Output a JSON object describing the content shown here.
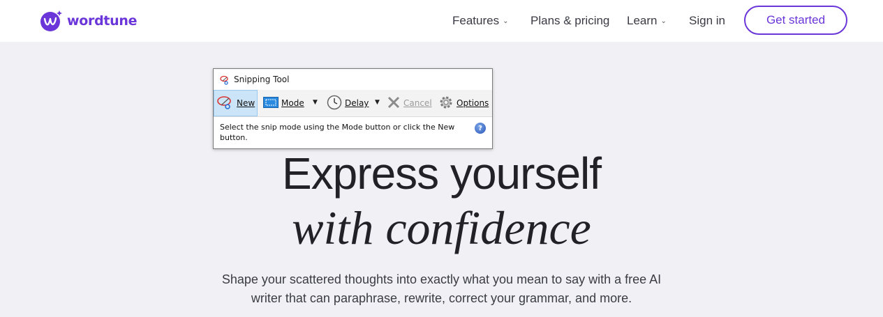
{
  "brand": {
    "name": "wordtune"
  },
  "nav": {
    "items": [
      {
        "label": "Features",
        "dropdown": true
      },
      {
        "label": "Plans & pricing",
        "dropdown": false
      },
      {
        "label": "Learn",
        "dropdown": true
      },
      {
        "label": "Sign in",
        "dropdown": false
      }
    ],
    "cta": "Get started"
  },
  "hero": {
    "line1": "Express yourself",
    "line2": "with confidence",
    "subtitle": "Shape your scattered thoughts into exactly what you mean to say with a free AI writer that can paraphrase, rewrite, correct your grammar, and more."
  },
  "snipping_tool": {
    "title": "Snipping Tool",
    "toolbar": {
      "new": "New",
      "mode": "Mode",
      "delay": "Delay",
      "cancel": "Cancel",
      "options": "Options"
    },
    "message": "Select the snip mode using the Mode button or click the New button."
  },
  "colors": {
    "brand": "#6a35d9",
    "page_bg": "#f1f0f4",
    "text_dark": "#222127"
  }
}
